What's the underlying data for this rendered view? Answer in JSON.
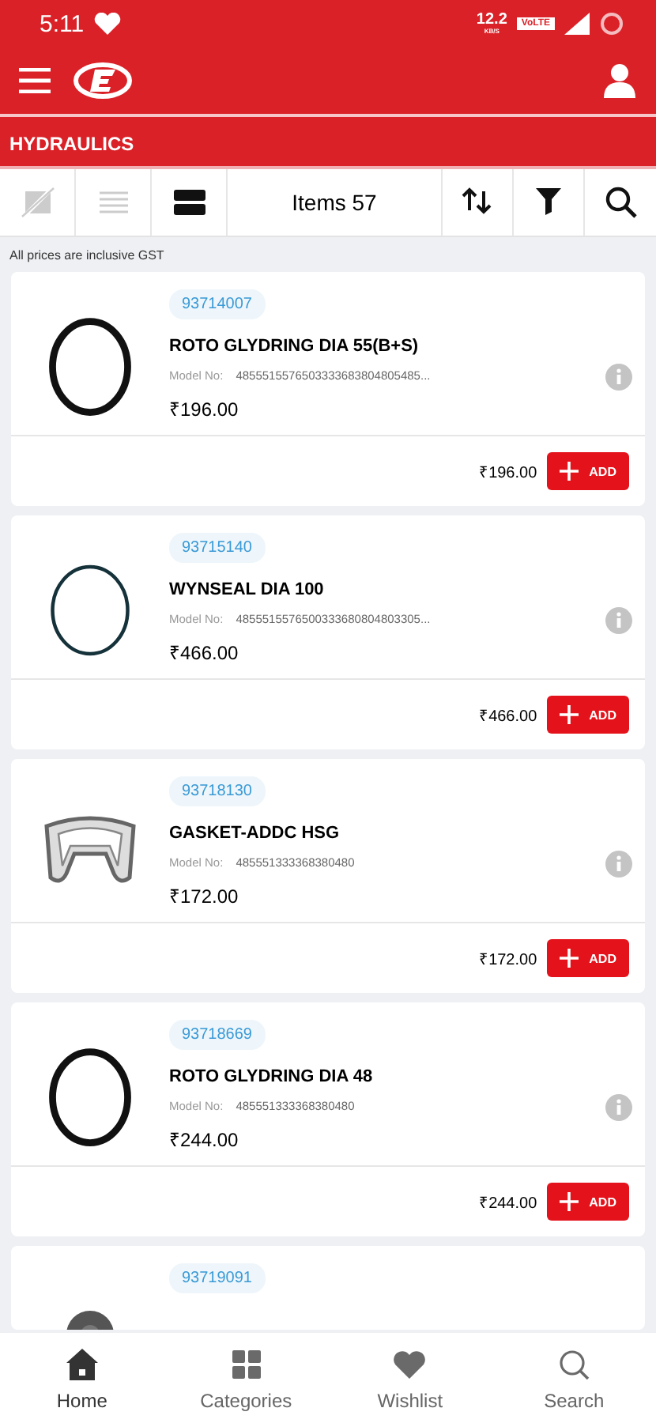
{
  "status_bar": {
    "time": "5:11",
    "speed": "12.2",
    "speed_unit": "KB/S",
    "network": "VoLTE"
  },
  "header": {
    "category": "HYDRAULICS"
  },
  "toolbar": {
    "views": [
      {
        "kind": "noimage",
        "selected": false
      },
      {
        "kind": "list",
        "selected": false
      },
      {
        "kind": "card",
        "selected": true
      }
    ],
    "count": "Items 57"
  },
  "note": "All prices are inclusive GST",
  "products": [
    {
      "kind": "ring",
      "code": "93714007",
      "name": "ROTO GLYDRING DIA 55(B+S)",
      "model_label": "Model No:",
      "model": "4855515576503333683804805485...",
      "price": "₹196.00",
      "total": "₹196.00",
      "button": "ADD"
    },
    {
      "kind": "thinring",
      "code": "93715140",
      "name": "WYNSEAL DIA 100",
      "model_label": "Model No:",
      "model": "4855515576500333680804803305...",
      "price": "₹466.00",
      "total": "₹466.00",
      "button": "ADD"
    },
    {
      "kind": "gasket",
      "code": "93718130",
      "name": "GASKET-ADDC HSG",
      "model_label": "Model No:",
      "model": "485551333368380480",
      "price": "₹172.00",
      "total": "₹172.00",
      "button": "ADD"
    },
    {
      "kind": "ring",
      "code": "93718669",
      "name": "ROTO GLYDRING DIA 48",
      "model_label": "Model No:",
      "model": "485551333368380480",
      "price": "₹244.00",
      "total": "₹244.00",
      "button": "ADD"
    },
    {
      "kind": "partial",
      "code": "93719091"
    }
  ],
  "bottom_nav": [
    {
      "kind": "home",
      "label": "Home",
      "selected": true
    },
    {
      "kind": "categories",
      "label": "Categories",
      "selected": false
    },
    {
      "kind": "wishlist",
      "label": "Wishlist",
      "selected": false
    },
    {
      "kind": "search",
      "label": "Search",
      "selected": false
    }
  ]
}
